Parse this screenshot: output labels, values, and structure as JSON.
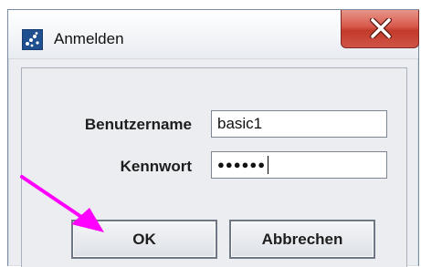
{
  "window": {
    "title": "Anmelden",
    "app_icon": "java-dots-icon",
    "close_icon": "close-x-icon"
  },
  "form": {
    "username_label": "Benutzername",
    "username_value": "basic1",
    "password_label": "Kennwort",
    "password_mask": "●●●●●●"
  },
  "buttons": {
    "ok_label": "OK",
    "cancel_label": "Abbrechen"
  },
  "annotation": {
    "arrow_icon": "pointer-arrow-icon",
    "arrow_color": "#ff00ff"
  },
  "colors": {
    "close_button": "#c94a3c",
    "dialog_background": "#ebedf1"
  }
}
